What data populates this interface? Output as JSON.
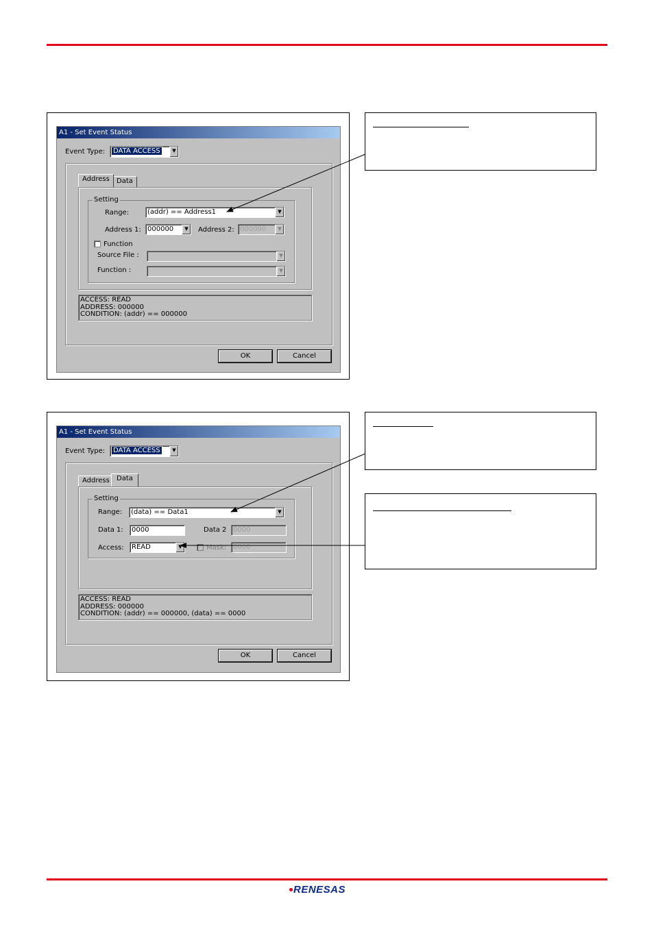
{
  "colors": {
    "accent_line": "#e3001b",
    "titlebar": "#08246b",
    "dialog_face": "#c0c0c0",
    "logo": "#0a2a8c"
  },
  "brand": {
    "logo_text": "RENESAS"
  },
  "dialogs": [
    {
      "title": "A1 - Set Event Status",
      "event_type_label": "Event Type:",
      "event_type_value": "DATA ACCESS",
      "tabs": [
        "Address",
        "Data"
      ],
      "active_tab": "Address",
      "group_label": "Setting",
      "range_label": "Range:",
      "range_value": "(addr) == Address1",
      "address1_label": "Address 1:",
      "address1_value": "000000",
      "address2_label": "Address 2:",
      "address2_value": "000000",
      "function_check_label": "Function",
      "source_file_label": "Source File :",
      "function_label": "Function :",
      "summary": [
        "ACCESS: READ",
        "ADDRESS: 000000",
        "CONDITION: (addr) == 000000"
      ],
      "ok_label": "OK",
      "cancel_label": "Cancel"
    },
    {
      "title": "A1 - Set Event Status",
      "event_type_label": "Event Type:",
      "event_type_value": "DATA ACCESS",
      "tabs": [
        "Address",
        "Data"
      ],
      "active_tab": "Data",
      "group_label": "Setting",
      "range_label": "Range:",
      "range_value": "(data) == Data1",
      "data1_label": "Data 1:",
      "data1_value": "0000",
      "data2_label": "Data 2",
      "data2_value": "0000",
      "access_label": "Access:",
      "access_value": "READ",
      "mask_label": "Mask:",
      "mask_value": "0000",
      "summary": [
        "ACCESS: READ",
        "ADDRESS: 000000",
        "CONDITION: (addr) == 000000, (data) == 0000"
      ],
      "ok_label": "OK",
      "cancel_label": "Cancel"
    }
  ]
}
